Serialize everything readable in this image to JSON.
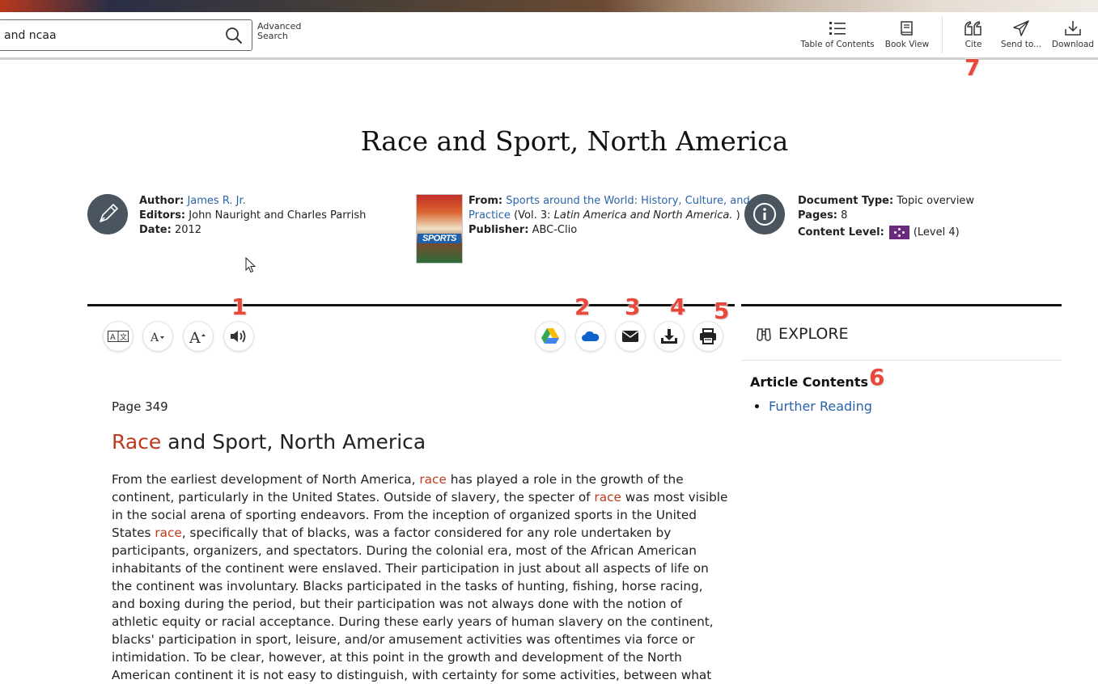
{
  "search": {
    "value": "and ncaa",
    "advanced_line1": "Advanced",
    "advanced_line2": "Search"
  },
  "toolbar": {
    "toc": "Table of Contents",
    "book_view": "Book View",
    "cite": "Cite",
    "send_to": "Send to...",
    "download": "Download"
  },
  "callouts": [
    "1",
    "2",
    "3",
    "4",
    "5",
    "6",
    "7"
  ],
  "document": {
    "title": "Race and Sport, North America",
    "author_label": "Author:",
    "author": "James R. Jr.",
    "editors_label": "Editors:",
    "editors": "John Nauright and Charles Parrish",
    "date_label": "Date:",
    "date": "2012",
    "from_label": "From:",
    "from_title_line1": "Sports around the World: History, Culture, and",
    "from_title_line2": "Practice",
    "from_vol_prefix": " (Vol. 3: ",
    "from_vol_title": "Latin America and North America.",
    "from_vol_suffix": " )",
    "publisher_label": "Publisher:",
    "publisher": "ABC-Clio",
    "doc_type_label": "Document Type:",
    "doc_type": "Topic overview",
    "pages_label": "Pages:",
    "pages": "8",
    "content_level_label": "Content Level:",
    "content_level": "(Level 4)",
    "cover_text": "SPORTS"
  },
  "explore": {
    "label": "EXPLORE",
    "article_contents": "Article Contents",
    "items": [
      "Further Reading"
    ]
  },
  "article": {
    "page": "Page 349",
    "title_highlight": "Race",
    "title_rest": " and Sport, North America",
    "lines": [
      [
        "From the earliest development of North America, ",
        "race",
        " has played a role in the growth of the"
      ],
      [
        "continent, particularly in the United States. Outside of slavery, the specter of ",
        "race",
        " was most visible"
      ],
      [
        "in the social arena of sporting endeavors. From the inception of organized sports in the United",
        "",
        ""
      ],
      [
        "States ",
        "race",
        ", specifically that of blacks, was a factor considered for any role undertaken by"
      ],
      [
        "participants, organizers, and spectators. During the colonial era, most of the African American",
        "",
        ""
      ],
      [
        "inhabitants of the continent were enslaved. Their participation in just about all aspects of life on",
        "",
        ""
      ],
      [
        "the continent was involuntary. Blacks participated in the tasks of hunting, fishing, horse racing,",
        "",
        ""
      ],
      [
        "and boxing during the period, but their participation was not always done with the notion of",
        "",
        ""
      ],
      [
        "athletic equity or racial acceptance. During these early years of human slavery on the continent,",
        "",
        ""
      ],
      [
        "blacks' participation in sport, leisure, and/or amusement activities was oftentimes via force or",
        "",
        ""
      ],
      [
        "intimidation. To be clear, however, at this point in the growth and development of the North",
        "",
        ""
      ],
      [
        "American continent it is not easy to distinguish, with certainty for some activities, between what",
        "",
        ""
      ]
    ]
  },
  "colors": {
    "highlight": "#c0391b",
    "link": "#2a63a8",
    "callout": "#e8473a",
    "level_badge": "#6b2b7d"
  }
}
